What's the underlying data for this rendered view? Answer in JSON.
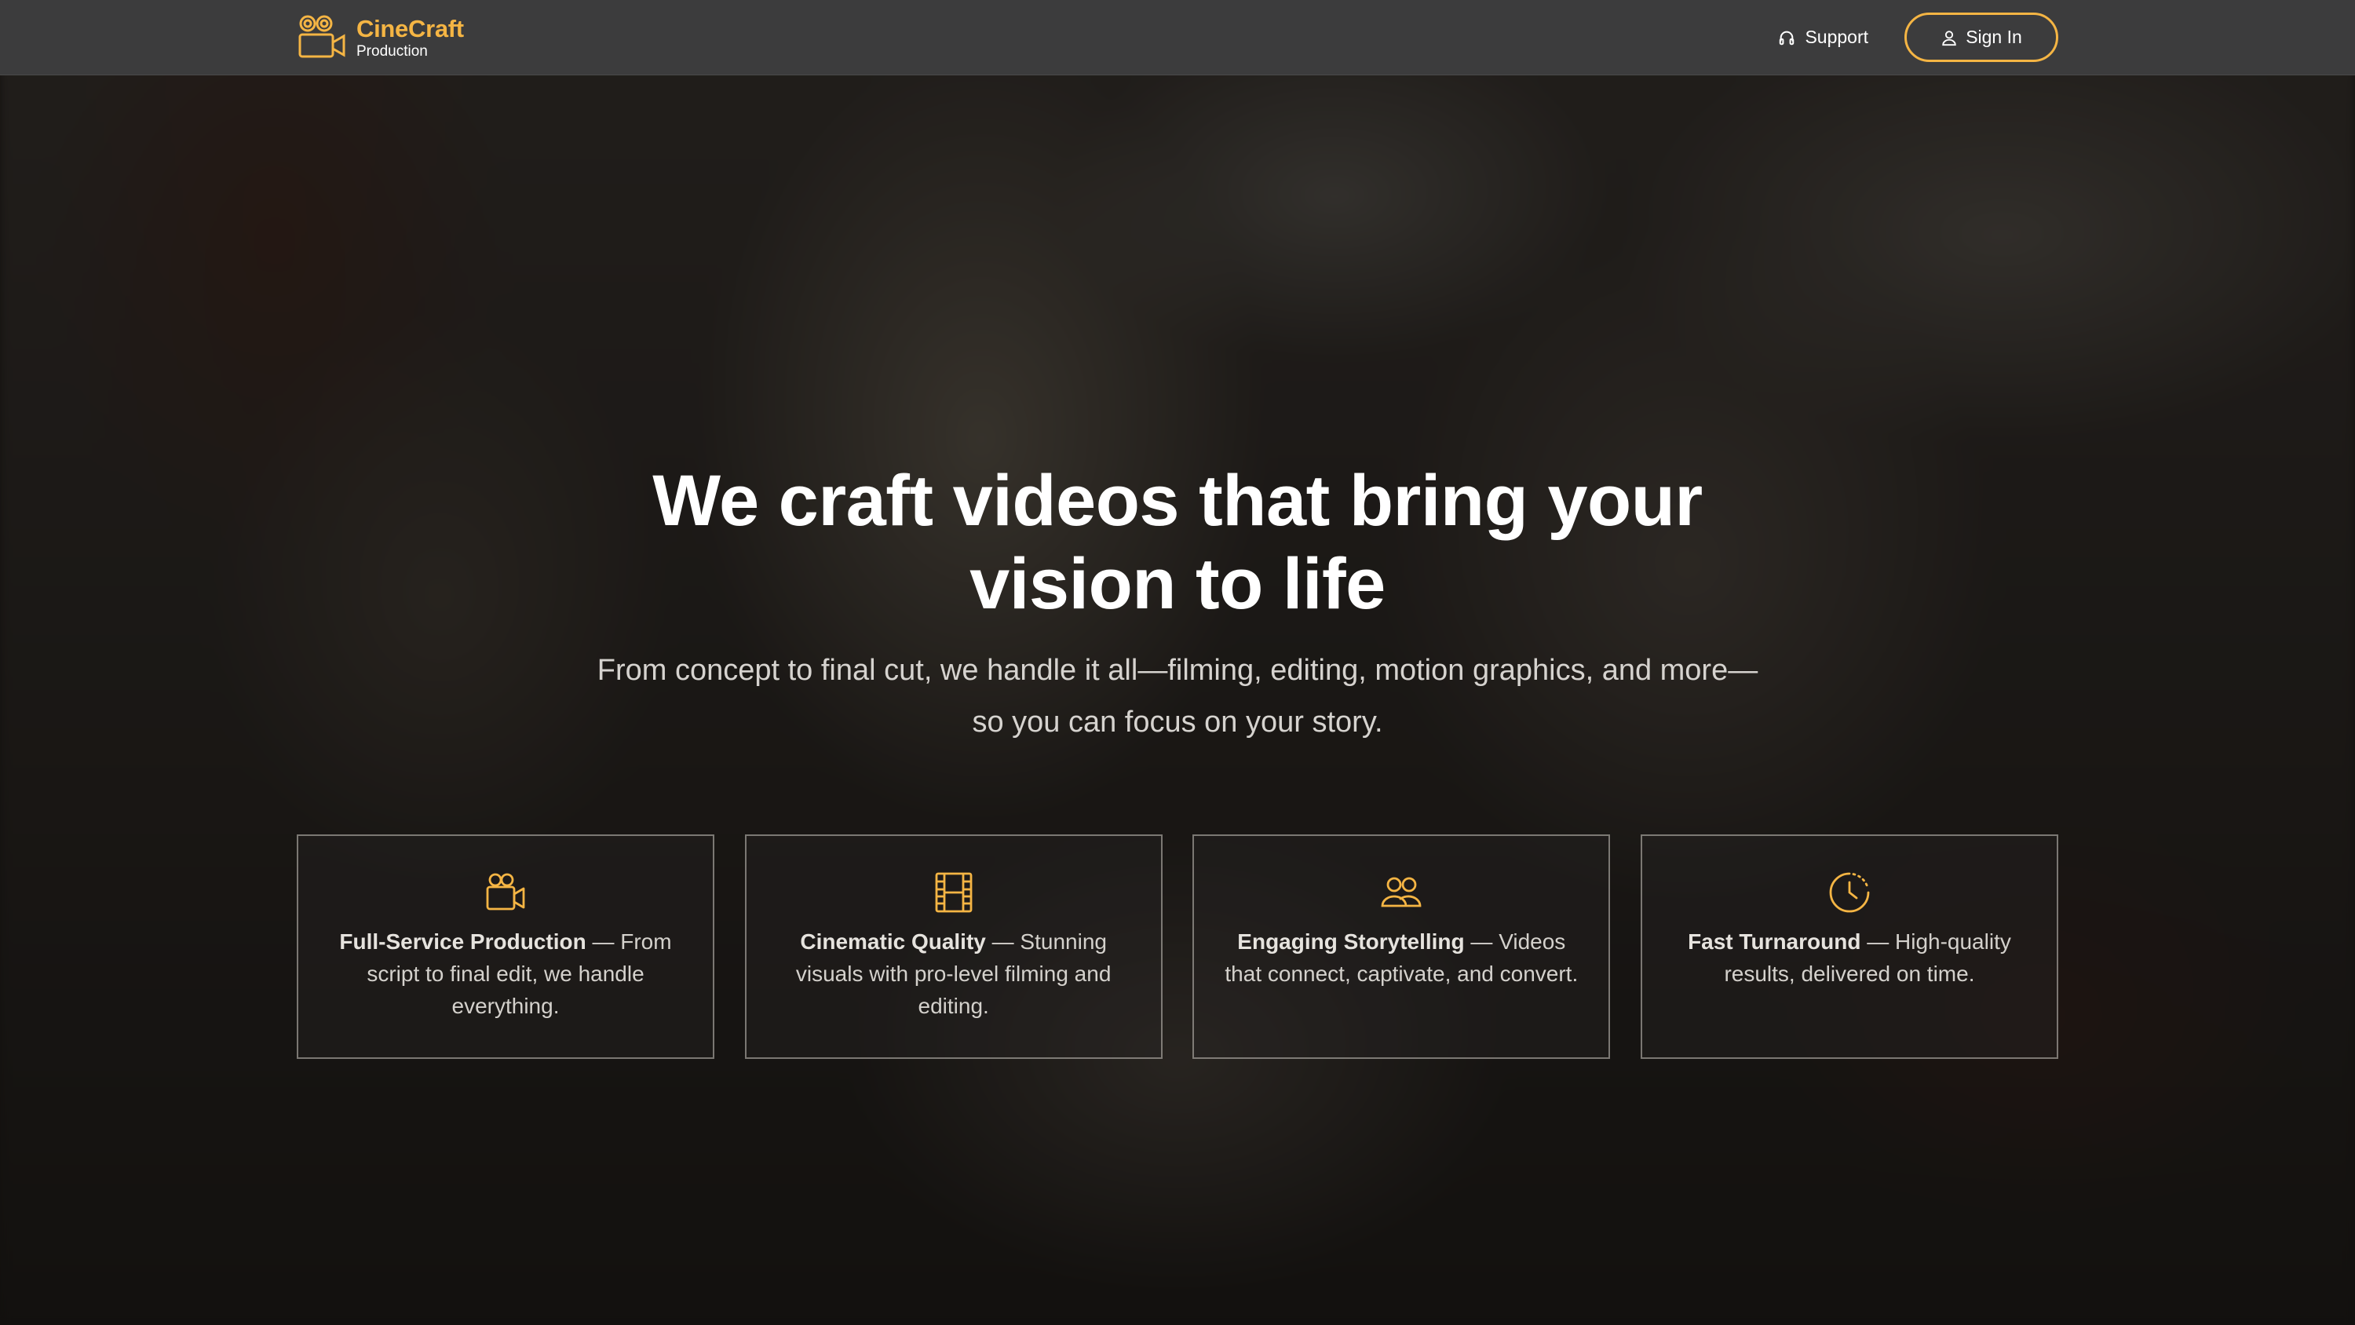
{
  "brand": {
    "name": "CineCraft",
    "subtitle": "Production",
    "logo_icon": "movie-camera-icon",
    "accent_color": "#f5b544"
  },
  "nav": {
    "support_label": "Support",
    "support_icon": "headphones-icon",
    "signin_label": "Sign In",
    "signin_icon": "user-icon"
  },
  "hero": {
    "title_line1": "We craft videos that bring your",
    "title_line2": "vision to life",
    "subtitle_line1": "From concept to final cut, we handle it all—filming, editing, motion graphics, and more—",
    "subtitle_line2": "so you can focus on your story."
  },
  "features": [
    {
      "icon": "video-camera-icon",
      "title": "Full-Service Production",
      "separator": " — ",
      "description": "From script to final edit, we handle everything."
    },
    {
      "icon": "film-strip-icon",
      "title": "Cinematic Quality",
      "separator": " — ",
      "description": "Stunning visuals with pro-level filming and editing."
    },
    {
      "icon": "users-icon",
      "title": "Engaging Storytelling",
      "separator": " — ",
      "description": "Videos that connect, captivate, and convert."
    },
    {
      "icon": "clock-icon",
      "title": "Fast Turnaround",
      "separator": " — ",
      "description": "High-quality results, delivered on time."
    }
  ]
}
